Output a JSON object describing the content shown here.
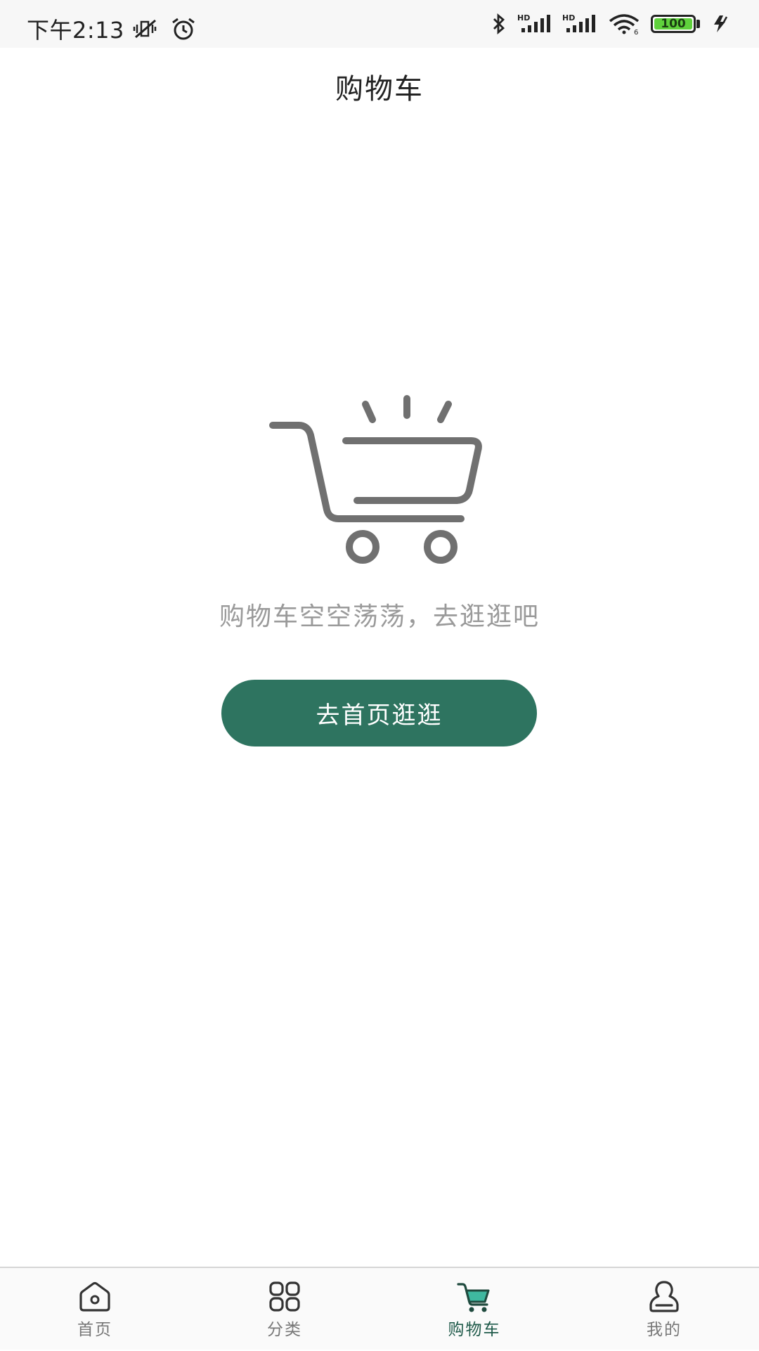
{
  "status_bar": {
    "time": "下午2:13",
    "battery_level": "100",
    "signal_hd_1": "HD",
    "signal_hd_2": "HD",
    "wifi_label": "6"
  },
  "header": {
    "title": "购物车"
  },
  "empty_state": {
    "message": "购物车空空荡荡，去逛逛吧",
    "button_label": "去首页逛逛"
  },
  "bottom_nav": {
    "items": [
      {
        "label": "首页",
        "icon": "home-icon",
        "active": false
      },
      {
        "label": "分类",
        "icon": "grid-icon",
        "active": false
      },
      {
        "label": "购物车",
        "icon": "cart-icon",
        "active": true
      },
      {
        "label": "我的",
        "icon": "user-icon",
        "active": false
      }
    ]
  },
  "colors": {
    "accent": "#2e7460",
    "active_icon": "#3fb8a0",
    "battery": "#5fd13c",
    "muted_text": "#9a9a9a"
  }
}
